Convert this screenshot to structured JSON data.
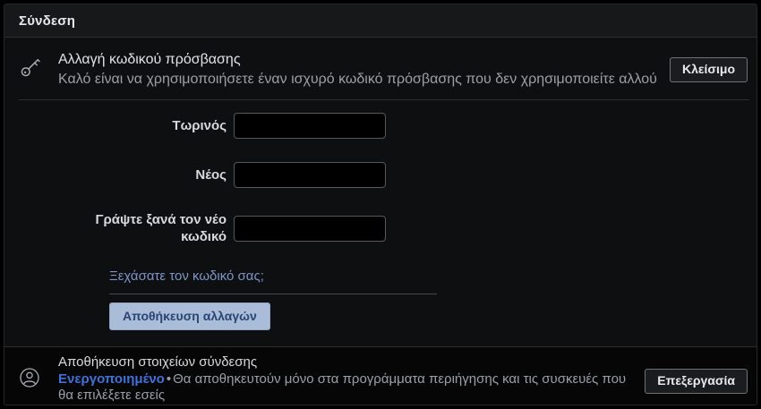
{
  "header": {
    "title": "Σύνδεση"
  },
  "password_section": {
    "title": "Αλλαγή κωδικού πρόσβασης",
    "subtitle": "Καλό είναι να χρησιμοποιήσετε έναν ισχυρό κωδικό πρόσβασης που δεν χρησιμοποιείτε αλλού",
    "close_label": "Κλείσιμο",
    "fields": [
      {
        "label": "Τωρινός",
        "value": ""
      },
      {
        "label": "Νέος",
        "value": ""
      },
      {
        "label": "Γράψτε ξανά τον νέο κωδικό",
        "value": ""
      }
    ],
    "forgot_link": "Ξεχάσατε τον κωδικό σας;",
    "save_label": "Αποθήκευση αλλαγών"
  },
  "save_login_section": {
    "title": "Αποθήκευση στοιχείων σύνδεσης",
    "status": "Ενεργοποιημένο",
    "separator": "•",
    "description": "Θα αποθηκευτούν μόνο στα προγράμματα περιήγησης και τις συσκευές που θα επιλέξετε εσείς",
    "edit_label": "Επεξεργασία"
  },
  "icons": {
    "key": "key-icon",
    "person": "person-icon"
  },
  "colors": {
    "link": "#7d95c9",
    "status": "#3d72d9",
    "saveBg": "#a9bcd8",
    "saveText": "#2d4373"
  }
}
